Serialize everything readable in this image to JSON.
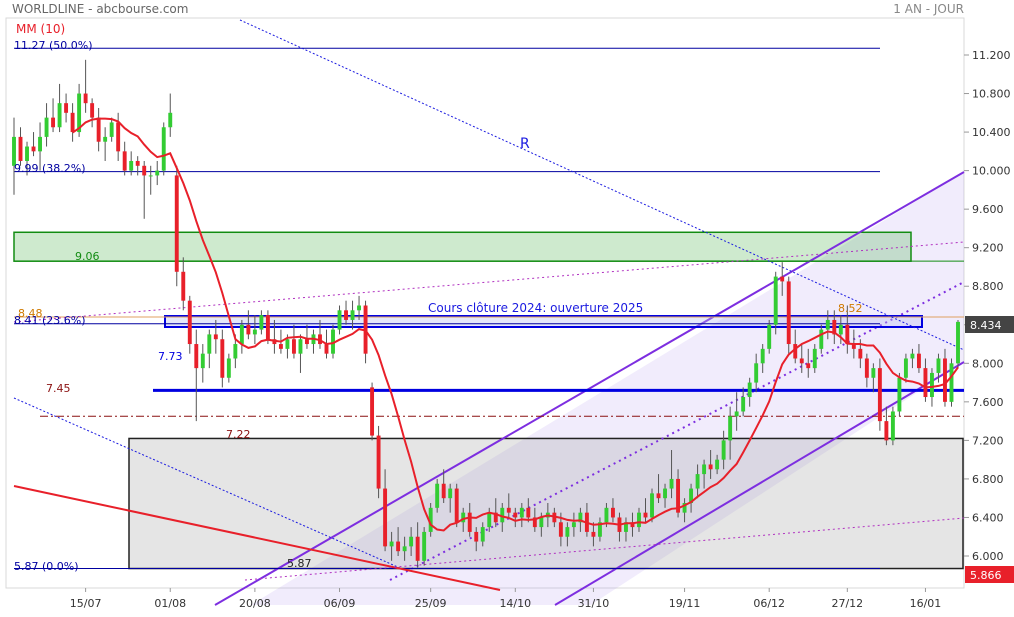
{
  "header": {
    "title": "WORLDLINE - abcbourse.com",
    "period": "1 AN - JOUR",
    "indicator": "MM (10)"
  },
  "colors": {
    "up": "#33cc33",
    "down": "#e8202a",
    "ma": "#e8202a",
    "fib": "#0000a0",
    "channel": "#7d2ee0",
    "support": "#0000e0",
    "resistance_zone": "#128c12",
    "price_badge": "#444444",
    "low_badge": "#e8202a"
  },
  "annotations": {
    "r_label": "R",
    "fib_50": "11.27  (50.0%)",
    "fib_382": "9.99  (38.2%)",
    "fib_236": "8.41  (23.6%)",
    "fib_0": "5.87  (0.0%)",
    "zone_906": "9.06",
    "val_848": "8.48",
    "val_773": "7.73",
    "val_745": "7.45",
    "val_722": "7.22",
    "val_587": "5.87",
    "val_852": "8.52",
    "box_label": "Cours clôture 2024: ouverture 2025",
    "last_price": "8.434",
    "low_price": "5.866"
  },
  "chart_data": {
    "type": "candlestick",
    "title": "WORLDLINE - abcbourse.com",
    "period": "1 AN - JOUR",
    "ylim": [
      5.87,
      11.5
    ],
    "yticks": [
      "11.200",
      "10.800",
      "10.400",
      "10.000",
      "9.600",
      "9.200",
      "8.800",
      "8.400",
      "8.000",
      "7.600",
      "7.200",
      "6.800",
      "6.400",
      "6.000"
    ],
    "xticks": [
      {
        "label": "15/07",
        "index": 11
      },
      {
        "label": "01/08",
        "index": 24
      },
      {
        "label": "20/08",
        "index": 37
      },
      {
        "label": "06/09",
        "index": 50
      },
      {
        "label": "25/09",
        "index": 64
      },
      {
        "label": "14/10",
        "index": 77
      },
      {
        "label": "31/10",
        "index": 89
      },
      {
        "label": "19/11",
        "index": 103
      },
      {
        "label": "06/12",
        "index": 116
      },
      {
        "label": "27/12",
        "index": 128
      },
      {
        "label": "16/01",
        "index": 140
      }
    ],
    "ma_period": 10,
    "series": [
      {
        "name": "MM (10)",
        "values": []
      }
    ],
    "candles": [
      [
        10.05,
        10.55,
        9.75,
        10.35
      ],
      [
        10.35,
        10.45,
        10.05,
        10.1
      ],
      [
        10.1,
        10.3,
        9.95,
        10.25
      ],
      [
        10.25,
        10.4,
        10.15,
        10.2
      ],
      [
        10.2,
        10.5,
        10.0,
        10.35
      ],
      [
        10.35,
        10.7,
        10.25,
        10.55
      ],
      [
        10.55,
        10.75,
        10.4,
        10.45
      ],
      [
        10.45,
        10.9,
        10.4,
        10.7
      ],
      [
        10.7,
        10.8,
        10.5,
        10.6
      ],
      [
        10.6,
        10.7,
        10.3,
        10.4
      ],
      [
        10.4,
        10.9,
        10.35,
        10.8
      ],
      [
        10.8,
        11.15,
        10.6,
        10.7
      ],
      [
        10.7,
        10.75,
        10.45,
        10.55
      ],
      [
        10.55,
        10.65,
        10.2,
        10.3
      ],
      [
        10.3,
        10.45,
        10.1,
        10.35
      ],
      [
        10.35,
        10.55,
        10.3,
        10.5
      ],
      [
        10.5,
        10.6,
        10.1,
        10.2
      ],
      [
        10.2,
        10.3,
        9.95,
        10.0
      ],
      [
        10.0,
        10.2,
        9.95,
        10.1
      ],
      [
        10.1,
        10.15,
        9.95,
        10.05
      ],
      [
        10.05,
        10.1,
        9.5,
        9.95
      ],
      [
        9.95,
        10.05,
        9.75,
        9.95
      ],
      [
        9.95,
        10.1,
        9.85,
        10.0
      ],
      [
        10.0,
        10.5,
        9.95,
        10.45
      ],
      [
        10.45,
        10.8,
        10.35,
        10.6
      ],
      [
        9.95,
        10.05,
        8.8,
        8.95
      ],
      [
        8.95,
        9.1,
        8.55,
        8.65
      ],
      [
        8.65,
        8.7,
        8.1,
        8.2
      ],
      [
        8.2,
        8.35,
        7.4,
        7.95
      ],
      [
        7.95,
        8.2,
        7.8,
        8.1
      ],
      [
        8.1,
        8.35,
        7.95,
        8.3
      ],
      [
        8.3,
        8.45,
        8.1,
        8.25
      ],
      [
        8.25,
        8.35,
        7.75,
        7.85
      ],
      [
        7.85,
        8.1,
        7.8,
        8.05
      ],
      [
        8.05,
        8.3,
        7.95,
        8.2
      ],
      [
        8.2,
        8.45,
        8.1,
        8.4
      ],
      [
        8.4,
        8.55,
        8.25,
        8.3
      ],
      [
        8.3,
        8.5,
        8.2,
        8.35
      ],
      [
        8.35,
        8.55,
        8.3,
        8.5
      ],
      [
        8.5,
        8.55,
        8.2,
        8.25
      ],
      [
        8.25,
        8.45,
        8.1,
        8.2
      ],
      [
        8.2,
        8.35,
        8.1,
        8.15
      ],
      [
        8.15,
        8.3,
        8.05,
        8.25
      ],
      [
        8.25,
        8.4,
        8.05,
        8.1
      ],
      [
        8.1,
        8.3,
        7.9,
        8.25
      ],
      [
        8.25,
        8.4,
        8.15,
        8.2
      ],
      [
        8.2,
        8.35,
        8.1,
        8.3
      ],
      [
        8.3,
        8.45,
        8.15,
        8.2
      ],
      [
        8.2,
        8.35,
        8.05,
        8.1
      ],
      [
        8.1,
        8.4,
        8.05,
        8.35
      ],
      [
        8.35,
        8.6,
        8.3,
        8.55
      ],
      [
        8.55,
        8.65,
        8.4,
        8.45
      ],
      [
        8.45,
        8.65,
        8.35,
        8.55
      ],
      [
        8.55,
        8.7,
        8.45,
        8.6
      ],
      [
        8.6,
        8.65,
        8.0,
        8.1
      ],
      [
        7.75,
        7.8,
        7.2,
        7.25
      ],
      [
        7.25,
        7.35,
        6.6,
        6.7
      ],
      [
        6.7,
        6.9,
        6.05,
        6.1
      ],
      [
        6.1,
        6.25,
        5.95,
        6.15
      ],
      [
        6.15,
        6.3,
        6.0,
        6.05
      ],
      [
        6.05,
        6.2,
        5.95,
        6.1
      ],
      [
        6.1,
        6.3,
        6.0,
        6.2
      ],
      [
        6.2,
        6.35,
        5.88,
        5.95
      ],
      [
        5.95,
        6.3,
        5.9,
        6.25
      ],
      [
        6.25,
        6.55,
        6.2,
        6.5
      ],
      [
        6.5,
        6.8,
        6.45,
        6.75
      ],
      [
        6.75,
        6.9,
        6.55,
        6.6
      ],
      [
        6.6,
        6.75,
        6.45,
        6.7
      ],
      [
        6.7,
        6.75,
        6.3,
        6.35
      ],
      [
        6.35,
        6.5,
        6.25,
        6.45
      ],
      [
        6.45,
        6.55,
        6.2,
        6.25
      ],
      [
        6.25,
        6.3,
        6.05,
        6.15
      ],
      [
        6.15,
        6.35,
        6.1,
        6.3
      ],
      [
        6.3,
        6.5,
        6.25,
        6.45
      ],
      [
        6.45,
        6.6,
        6.3,
        6.35
      ],
      [
        6.35,
        6.55,
        6.25,
        6.5
      ],
      [
        6.5,
        6.65,
        6.4,
        6.45
      ],
      [
        6.45,
        6.5,
        6.3,
        6.4
      ],
      [
        6.4,
        6.55,
        6.3,
        6.5
      ],
      [
        6.5,
        6.6,
        6.35,
        6.4
      ],
      [
        6.4,
        6.5,
        6.25,
        6.3
      ],
      [
        6.3,
        6.45,
        6.2,
        6.4
      ],
      [
        6.4,
        6.55,
        6.3,
        6.45
      ],
      [
        6.45,
        6.5,
        6.3,
        6.35
      ],
      [
        6.35,
        6.45,
        6.1,
        6.2
      ],
      [
        6.2,
        6.35,
        6.1,
        6.3
      ],
      [
        6.3,
        6.45,
        6.2,
        6.35
      ],
      [
        6.35,
        6.5,
        6.25,
        6.45
      ],
      [
        6.45,
        6.55,
        6.2,
        6.25
      ],
      [
        6.25,
        6.35,
        6.1,
        6.2
      ],
      [
        6.2,
        6.4,
        6.15,
        6.35
      ],
      [
        6.35,
        6.55,
        6.3,
        6.5
      ],
      [
        6.5,
        6.6,
        6.35,
        6.4
      ],
      [
        6.4,
        6.45,
        6.15,
        6.25
      ],
      [
        6.25,
        6.4,
        6.15,
        6.35
      ],
      [
        6.35,
        6.45,
        6.2,
        6.3
      ],
      [
        6.3,
        6.5,
        6.25,
        6.45
      ],
      [
        6.45,
        6.6,
        6.35,
        6.4
      ],
      [
        6.4,
        6.7,
        6.35,
        6.65
      ],
      [
        6.65,
        6.85,
        6.55,
        6.6
      ],
      [
        6.6,
        6.75,
        6.5,
        6.7
      ],
      [
        6.7,
        7.1,
        6.6,
        6.8
      ],
      [
        6.8,
        6.9,
        6.4,
        6.45
      ],
      [
        6.45,
        6.6,
        6.35,
        6.55
      ],
      [
        6.55,
        6.75,
        6.45,
        6.7
      ],
      [
        6.7,
        6.95,
        6.6,
        6.85
      ],
      [
        6.85,
        7.0,
        6.7,
        6.95
      ],
      [
        6.95,
        7.1,
        6.8,
        6.9
      ],
      [
        6.9,
        7.05,
        6.85,
        7.0
      ],
      [
        7.0,
        7.3,
        6.9,
        7.2
      ],
      [
        7.2,
        7.55,
        7.0,
        7.45
      ],
      [
        7.45,
        7.7,
        7.3,
        7.5
      ],
      [
        7.5,
        7.75,
        7.45,
        7.65
      ],
      [
        7.65,
        7.85,
        7.55,
        7.8
      ],
      [
        7.8,
        8.1,
        7.7,
        8.0
      ],
      [
        8.0,
        8.2,
        7.9,
        8.15
      ],
      [
        8.15,
        8.45,
        8.1,
        8.4
      ],
      [
        8.4,
        8.95,
        8.3,
        8.9
      ],
      [
        8.9,
        9.05,
        8.7,
        8.85
      ],
      [
        8.85,
        8.9,
        8.1,
        8.2
      ],
      [
        8.2,
        8.35,
        8.0,
        8.05
      ],
      [
        8.05,
        8.2,
        7.9,
        8.0
      ],
      [
        8.0,
        8.15,
        7.85,
        7.95
      ],
      [
        7.95,
        8.2,
        7.9,
        8.15
      ],
      [
        8.15,
        8.4,
        8.1,
        8.35
      ],
      [
        8.35,
        8.55,
        8.25,
        8.45
      ],
      [
        8.45,
        8.55,
        8.2,
        8.3
      ],
      [
        8.3,
        8.5,
        8.2,
        8.4
      ],
      [
        8.4,
        8.6,
        8.1,
        8.2
      ],
      [
        8.2,
        8.35,
        8.05,
        8.15
      ],
      [
        8.15,
        8.25,
        7.95,
        8.05
      ],
      [
        8.05,
        8.1,
        7.75,
        7.85
      ],
      [
        7.85,
        8.0,
        7.7,
        7.95
      ],
      [
        7.95,
        8.05,
        7.3,
        7.4
      ],
      [
        7.4,
        7.55,
        7.15,
        7.2
      ],
      [
        7.2,
        7.55,
        7.15,
        7.5
      ],
      [
        7.5,
        7.9,
        7.45,
        7.85
      ],
      [
        7.85,
        8.1,
        7.8,
        8.05
      ],
      [
        8.05,
        8.15,
        7.95,
        8.1
      ],
      [
        8.1,
        8.2,
        7.9,
        7.95
      ],
      [
        7.95,
        8.05,
        7.6,
        7.65
      ],
      [
        7.65,
        7.95,
        7.55,
        7.9
      ],
      [
        7.9,
        8.1,
        7.8,
        8.05
      ],
      [
        8.05,
        8.15,
        7.55,
        7.6
      ],
      [
        7.6,
        8.05,
        7.55,
        8.0
      ],
      [
        8.0,
        8.45,
        7.95,
        8.43
      ]
    ],
    "levels": [
      {
        "value": 11.27,
        "label": "11.27  (50.0%)"
      },
      {
        "value": 9.99,
        "label": "9.99  (38.2%)"
      },
      {
        "value": 8.41,
        "label": "8.41  (23.6%)"
      },
      {
        "value": 8.48,
        "label": "8.48"
      },
      {
        "value": 7.73,
        "label": "7.73"
      },
      {
        "value": 7.45,
        "label": "7.45"
      },
      {
        "value": 7.22,
        "label": "7.22"
      },
      {
        "value": 5.87,
        "label": "5.87  (0.0%)"
      }
    ],
    "zones": [
      {
        "from": 9.06,
        "to": 9.36,
        "label": "9.06"
      },
      {
        "from": 8.41,
        "to": 8.52,
        "label": "Cours clôture 2024: ouverture 2025"
      },
      {
        "from": 5.87,
        "to": 7.22,
        "label": ""
      }
    ],
    "last_price": 8.434,
    "low_price": 5.866
  }
}
